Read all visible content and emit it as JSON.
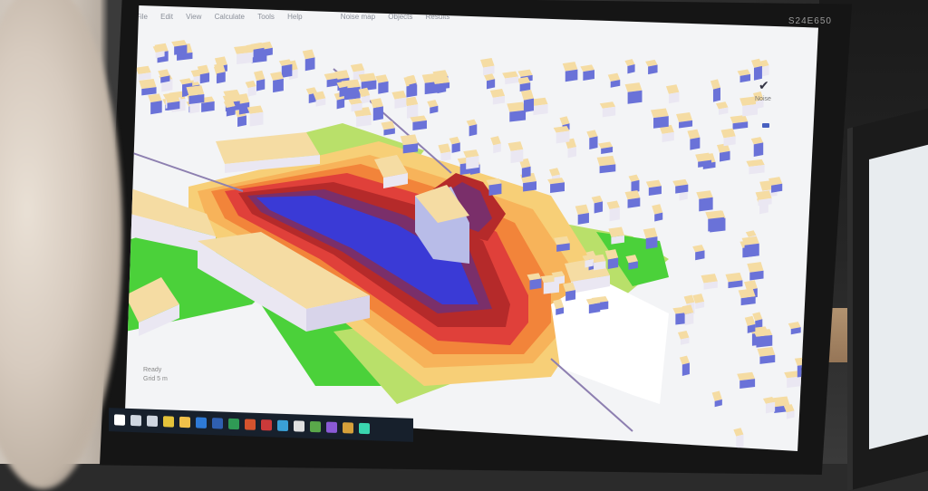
{
  "monitor": {
    "brand_label": "S24E650"
  },
  "app": {
    "menu_items": [
      "File",
      "Edit",
      "View",
      "Calculate",
      "Tools",
      "Help"
    ],
    "toolbar_tabs": [
      "Noise map",
      "Objects",
      "Results"
    ],
    "right_panel": {
      "check_label": "✔",
      "panel_label": "Noise"
    },
    "status_lines": [
      "Ready",
      "Grid 5 m"
    ]
  },
  "map": {
    "noise_band_colors": {
      "band_1_dark_blue": "#3a3ad6",
      "band_2_purple": "#7a2f6a",
      "band_3_dark_red": "#b52a2a",
      "band_4_red": "#e0403a",
      "band_5_orange": "#f2843a",
      "band_6_light_orange": "#f7b35a",
      "band_7_yellow": "#f7cf77",
      "band_8_light_green": "#b9e06a",
      "band_9_green": "#4bd13a"
    },
    "building_colors": {
      "roof": "#f5dca3",
      "side_blue": "#6a72d8",
      "side_light": "#eae7f2"
    }
  },
  "taskbar": {
    "icons": [
      {
        "name": "windows-icon",
        "color": "#ffffff"
      },
      {
        "name": "search-icon",
        "color": "#cfd6e0"
      },
      {
        "name": "task-view-icon",
        "color": "#cfd6e0"
      },
      {
        "name": "chrome-icon",
        "color": "#e5c33a"
      },
      {
        "name": "explorer-icon",
        "color": "#f0c04a"
      },
      {
        "name": "outlook-icon",
        "color": "#2e7ad6"
      },
      {
        "name": "word-icon",
        "color": "#2f5fb0"
      },
      {
        "name": "excel-icon",
        "color": "#2f9a55"
      },
      {
        "name": "powerpoint-icon",
        "color": "#d4532e"
      },
      {
        "name": "app-icon-1",
        "color": "#cc3a3a"
      },
      {
        "name": "app-icon-2",
        "color": "#3aa0d6"
      },
      {
        "name": "app-icon-3",
        "color": "#e0e0e0"
      },
      {
        "name": "app-icon-4",
        "color": "#5aa84a"
      },
      {
        "name": "app-icon-5",
        "color": "#8a5ad6"
      },
      {
        "name": "app-icon-6",
        "color": "#d6a03a"
      },
      {
        "name": "app-icon-7",
        "color": "#3ad6b0"
      }
    ]
  }
}
